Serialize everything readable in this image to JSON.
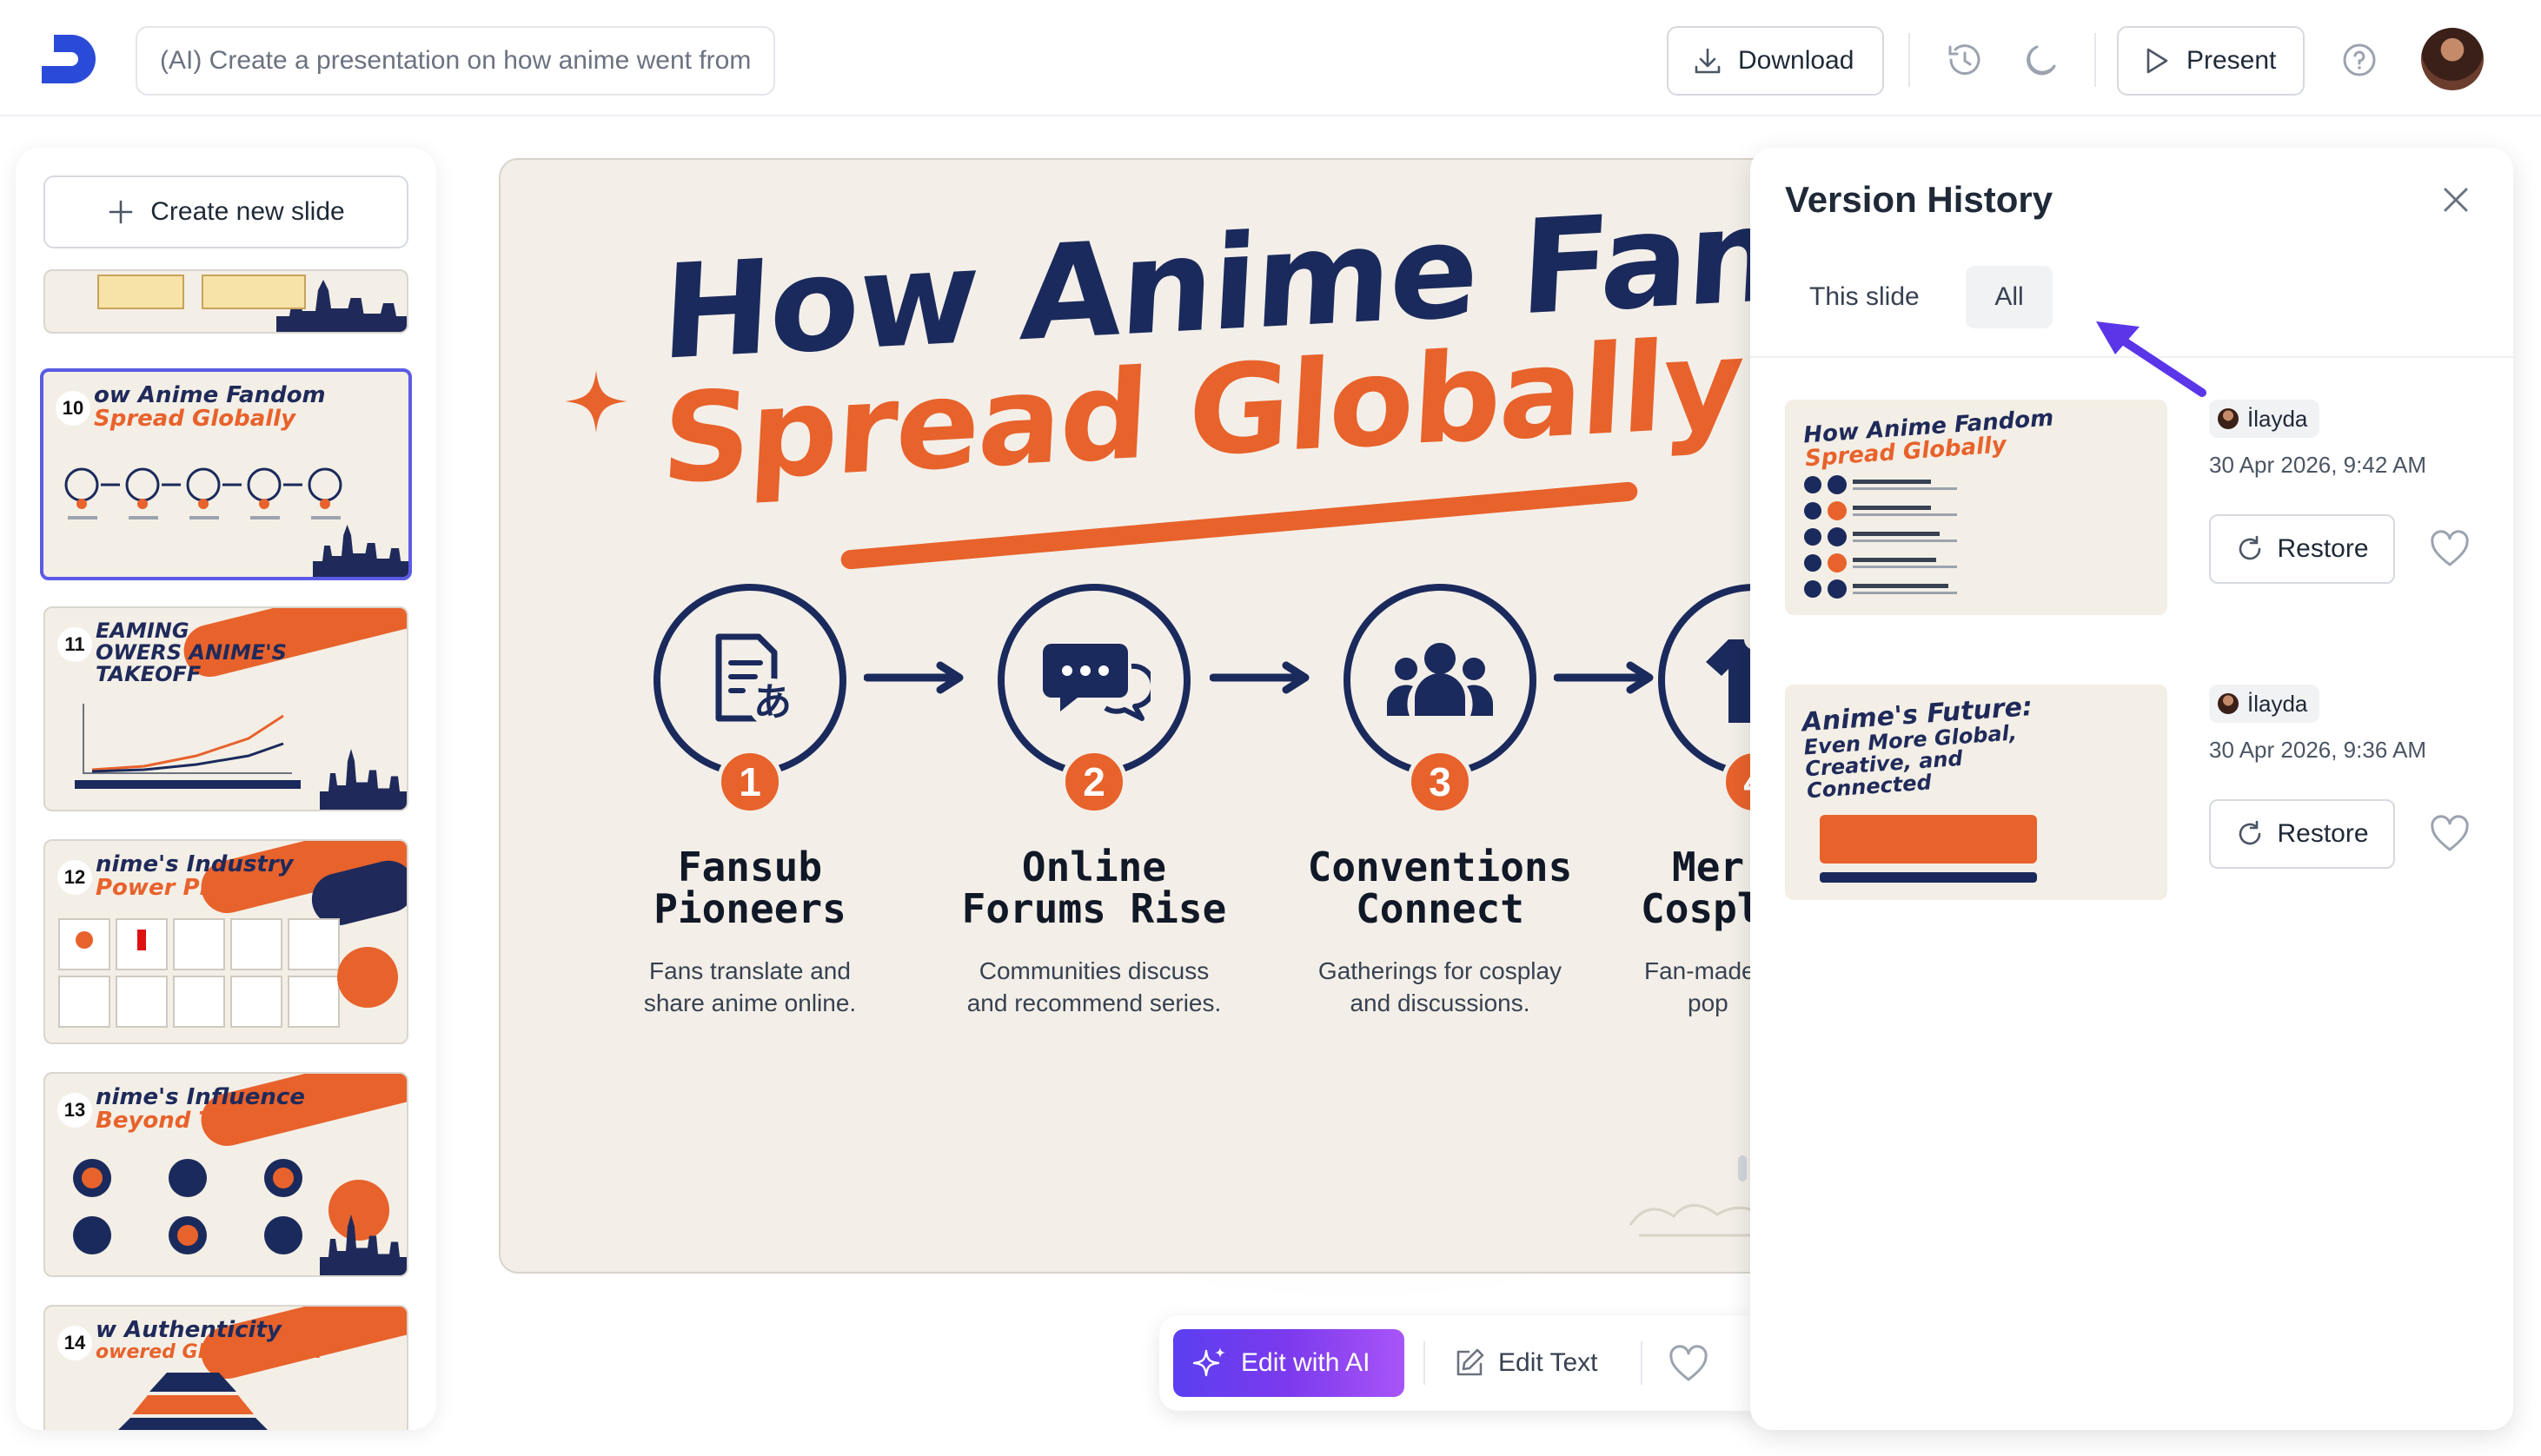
{
  "header": {
    "prompt_text": "(AI) Create a presentation on how anime went from",
    "download_label": "Download",
    "present_label": "Present"
  },
  "sidebar": {
    "create_label": "Create new slide",
    "slides": [
      {
        "number": "",
        "title_line1": "",
        "title_line2": ""
      },
      {
        "number": "10",
        "title_line1": "ow Anime Fandom",
        "title_line2": "Spread Globally"
      },
      {
        "number": "11",
        "title_line1": "EAMING",
        "title_line2": "OWERS ANIME'S TAKEOFF"
      },
      {
        "number": "12",
        "title_line1": "nime's Industry",
        "title_line2": "Power Players"
      },
      {
        "number": "13",
        "title_line1": "nime's Influence",
        "title_line2": "Beyond TV"
      },
      {
        "number": "14",
        "title_line1": "w Authenticity",
        "title_line2": "owered Global Reach"
      }
    ]
  },
  "slide": {
    "title_line1": "How Anime Fando",
    "title_line2": "Spread Globally",
    "steps": [
      {
        "badge": "1",
        "name_line1": "Fansub",
        "name_line2": "Pioneers",
        "desc_line1": "Fans translate and",
        "desc_line2": "share anime online."
      },
      {
        "badge": "2",
        "name_line1": "Online",
        "name_line2": "Forums Rise",
        "desc_line1": "Communities discuss",
        "desc_line2": "and recommend series."
      },
      {
        "badge": "3",
        "name_line1": "Conventions",
        "name_line2": "Connect",
        "desc_line1": "Gatherings for cosplay",
        "desc_line2": "and discussions."
      },
      {
        "badge": "4",
        "name_line1": "Mer",
        "name_line2": "Cospla",
        "desc_line1": "Fan-made",
        "desc_line2": "pop"
      }
    ]
  },
  "toolbar": {
    "edit_ai_label": "Edit with AI",
    "edit_text_label": "Edit Text"
  },
  "version_history": {
    "title": "Version History",
    "tab_this": "This slide",
    "tab_all": "All",
    "versions": [
      {
        "user": "İlayda",
        "time": "30 Apr 2026, 9:42 AM",
        "restore_label": "Restore",
        "thumb_line1": "How Anime Fandom",
        "thumb_line2": "Spread Globally"
      },
      {
        "user": "İlayda",
        "time": "30 Apr 2026, 9:36 AM",
        "restore_label": "Restore",
        "thumb_line1": "Anime's Future:",
        "thumb_line2": "Even More Global, Creative, and Connected"
      }
    ]
  },
  "colors": {
    "navy": "#1b2a5c",
    "orange": "#e8622c",
    "accent_purple": "#5b3ff0",
    "arrow_purple": "#5b35e8"
  }
}
